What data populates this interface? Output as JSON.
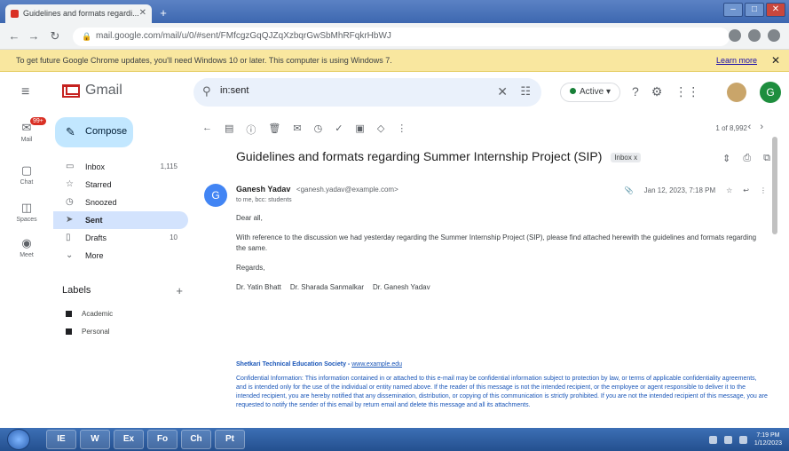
{
  "browser": {
    "tab_title": "Guidelines and formats regardi...",
    "url": "mail.google.com/mail/u/0/#sent/FMfcgzGqQJZqXzbqrGwSbMhRFqkrHbWJ",
    "infobar_text": "To get future Google Chrome updates, you'll need Windows 10 or later. This computer is using Windows 7.",
    "infobar_link": "Learn more"
  },
  "gmail": {
    "logo_text": "Gmail",
    "search_value": "in:sent",
    "status_label": "Active",
    "avatar_letter": "G",
    "rail": [
      {
        "label": "Mail",
        "badge": "99+",
        "icon": "mail-icon"
      },
      {
        "label": "Chat",
        "icon": "chat-icon"
      },
      {
        "label": "Spaces",
        "icon": "spaces-icon"
      },
      {
        "label": "Meet",
        "icon": "meet-icon"
      }
    ],
    "compose_label": "Compose",
    "nav": [
      {
        "label": "Inbox",
        "count": "1,115",
        "icon": "inbox-icon"
      },
      {
        "label": "Starred",
        "count": "",
        "icon": "star-icon"
      },
      {
        "label": "Snoozed",
        "count": "",
        "icon": "clock-icon"
      },
      {
        "label": "Sent",
        "count": "",
        "icon": "send-icon"
      },
      {
        "label": "Drafts",
        "count": "10",
        "icon": "draft-icon"
      },
      {
        "label": "More",
        "count": "",
        "icon": "chevron-down-icon"
      }
    ],
    "labels_heading": "Labels",
    "labels": [
      "Academic",
      "Personal"
    ]
  },
  "message": {
    "pager": "1 of 8,992",
    "subject": "Guidelines and formats regarding Summer Internship Project (SIP)",
    "folder_chip": "Inbox x",
    "sender_initial": "G",
    "sender_name": "Ganesh Yadav",
    "sender_address": "<ganesh.yadav@example.com>",
    "to_line": "to me, bcc: students",
    "date": "Jan 12, 2023, 7:18 PM",
    "greeting": "Dear all,",
    "body": "With reference to the discussion we had yesterday regarding the Summer Internship Project (SIP), please find attached herewith the guidelines and formats regarding the same.",
    "regards": "Regards,",
    "signatories": [
      "Dr. Yatin Bhatt",
      "Dr. Sharada Sanmalkar",
      "Dr. Ganesh Yadav"
    ],
    "footer_title": "Shetkari Technical Education Society",
    "footer_link": "www.example.edu",
    "footer_text": "Confidential Information: This information contained in or attached to this e-mail may be confidential information subject to protection by law, or terms of applicable confidentiality agreements, and is intended only for the use of the individual or entity named above. If the reader of this message is not the intended recipient, or the employee or agent responsible to deliver it to the intended recipient, you are hereby notified that any dissemination, distribution, or copying of this communication is strictly prohibited. If you are not the intended recipient of this message, you are requested to notify the sender of this email by return email and delete this message and all its attachments."
  },
  "taskbar": {
    "apps": [
      "IE",
      "W",
      "Ex",
      "Fo",
      "Ch",
      "Pt"
    ],
    "time": "7:19 PM",
    "date": "1/12/2023"
  }
}
